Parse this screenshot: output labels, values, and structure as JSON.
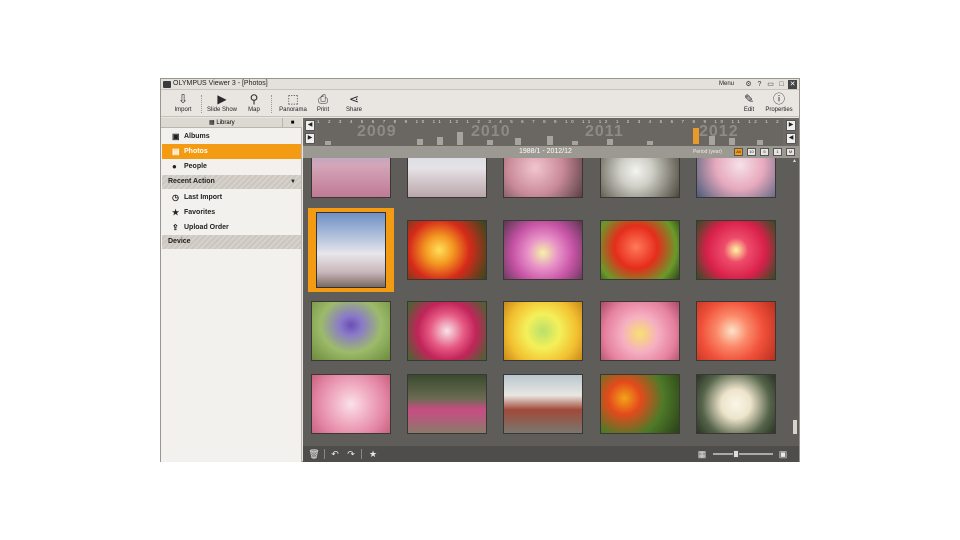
{
  "window": {
    "title": "OLYMPUS Viewer 3 - [Photos]",
    "menu_label": "Menu",
    "controls": [
      "gear-icon",
      "help-icon",
      "minimize-icon",
      "maximize-icon",
      "close-icon"
    ]
  },
  "toolbar": {
    "import": "Import",
    "slideshow": "Slide Show",
    "map": "Map",
    "panorama": "Panorama",
    "print": "Print",
    "share": "Share",
    "edit": "Edit",
    "properties": "Properties"
  },
  "sidebar": {
    "library_label": "Library",
    "items": [
      {
        "label": "Albums",
        "icon": "album-icon"
      },
      {
        "label": "Photos",
        "icon": "photos-icon",
        "selected": true
      },
      {
        "label": "People",
        "icon": "people-icon"
      }
    ],
    "recent_action": {
      "label": "Recent Action",
      "items": [
        {
          "label": "Last Import",
          "icon": "clock-icon"
        },
        {
          "label": "Favorites",
          "icon": "star-icon"
        },
        {
          "label": "Upload Order",
          "icon": "upload-icon"
        }
      ]
    },
    "device_label": "Device"
  },
  "timeline": {
    "years": [
      "2009",
      "2010",
      "2011",
      "2012"
    ],
    "months": "1 2 3 4 5 6 7 8 9 10 11 12 1 2 3 4 5 6 7 8 9 10 11 12 1 2 3 4 5 6 7 8 9 10 11 12 1 2 3 4 5 6 7 8 9 10 11 12",
    "range_text": "1988/1 - 2012/12",
    "period_label": "Period (year)",
    "period_buttons": [
      "All",
      "10",
      "5",
      "1",
      "M"
    ]
  },
  "grid": {
    "selected_index": 5,
    "columns": 5,
    "rows": 5
  },
  "colors": {
    "accent": "#f39c13",
    "main_bg": "#5f5d5a"
  }
}
